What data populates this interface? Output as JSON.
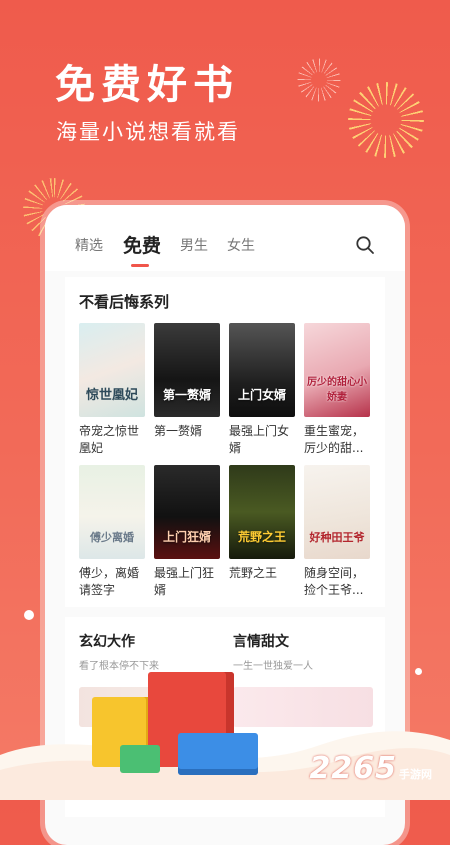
{
  "promo": {
    "headline": "免费好书",
    "subline": "海量小说想看就看"
  },
  "tabs": [
    {
      "label": "精选"
    },
    {
      "label": "免费"
    },
    {
      "label": "男生"
    },
    {
      "label": "女生"
    }
  ],
  "section": {
    "title": "不看后悔系列",
    "books": [
      {
        "title": "帝宠之惊世凰妃",
        "cover_text": "惊世凰妃"
      },
      {
        "title": "第一赘婿",
        "cover_text": "第一赘婿"
      },
      {
        "title": "最强上门女婿",
        "cover_text": "上门女婿"
      },
      {
        "title": "重生蜜宠，厉少的甜...",
        "cover_text": "厉少的甜心小娇妻"
      },
      {
        "title": "傅少，离婚请签字",
        "cover_text": "傅少离婚"
      },
      {
        "title": "最强上门狂婿",
        "cover_text": "上门狂婿"
      },
      {
        "title": "荒野之王",
        "cover_text": "荒野之王"
      },
      {
        "title": "随身空间，捡个王爷...",
        "cover_text": "好种田王爷"
      }
    ]
  },
  "categories": [
    {
      "name": "玄幻大作",
      "desc": "看了根本停不下来"
    },
    {
      "name": "言情甜文",
      "desc": "一生一世独爱一人"
    }
  ],
  "brand": {
    "number": "2265",
    "text": "手游网"
  },
  "colors": {
    "accent": "#f0554a",
    "background": "#ef5b4c"
  }
}
